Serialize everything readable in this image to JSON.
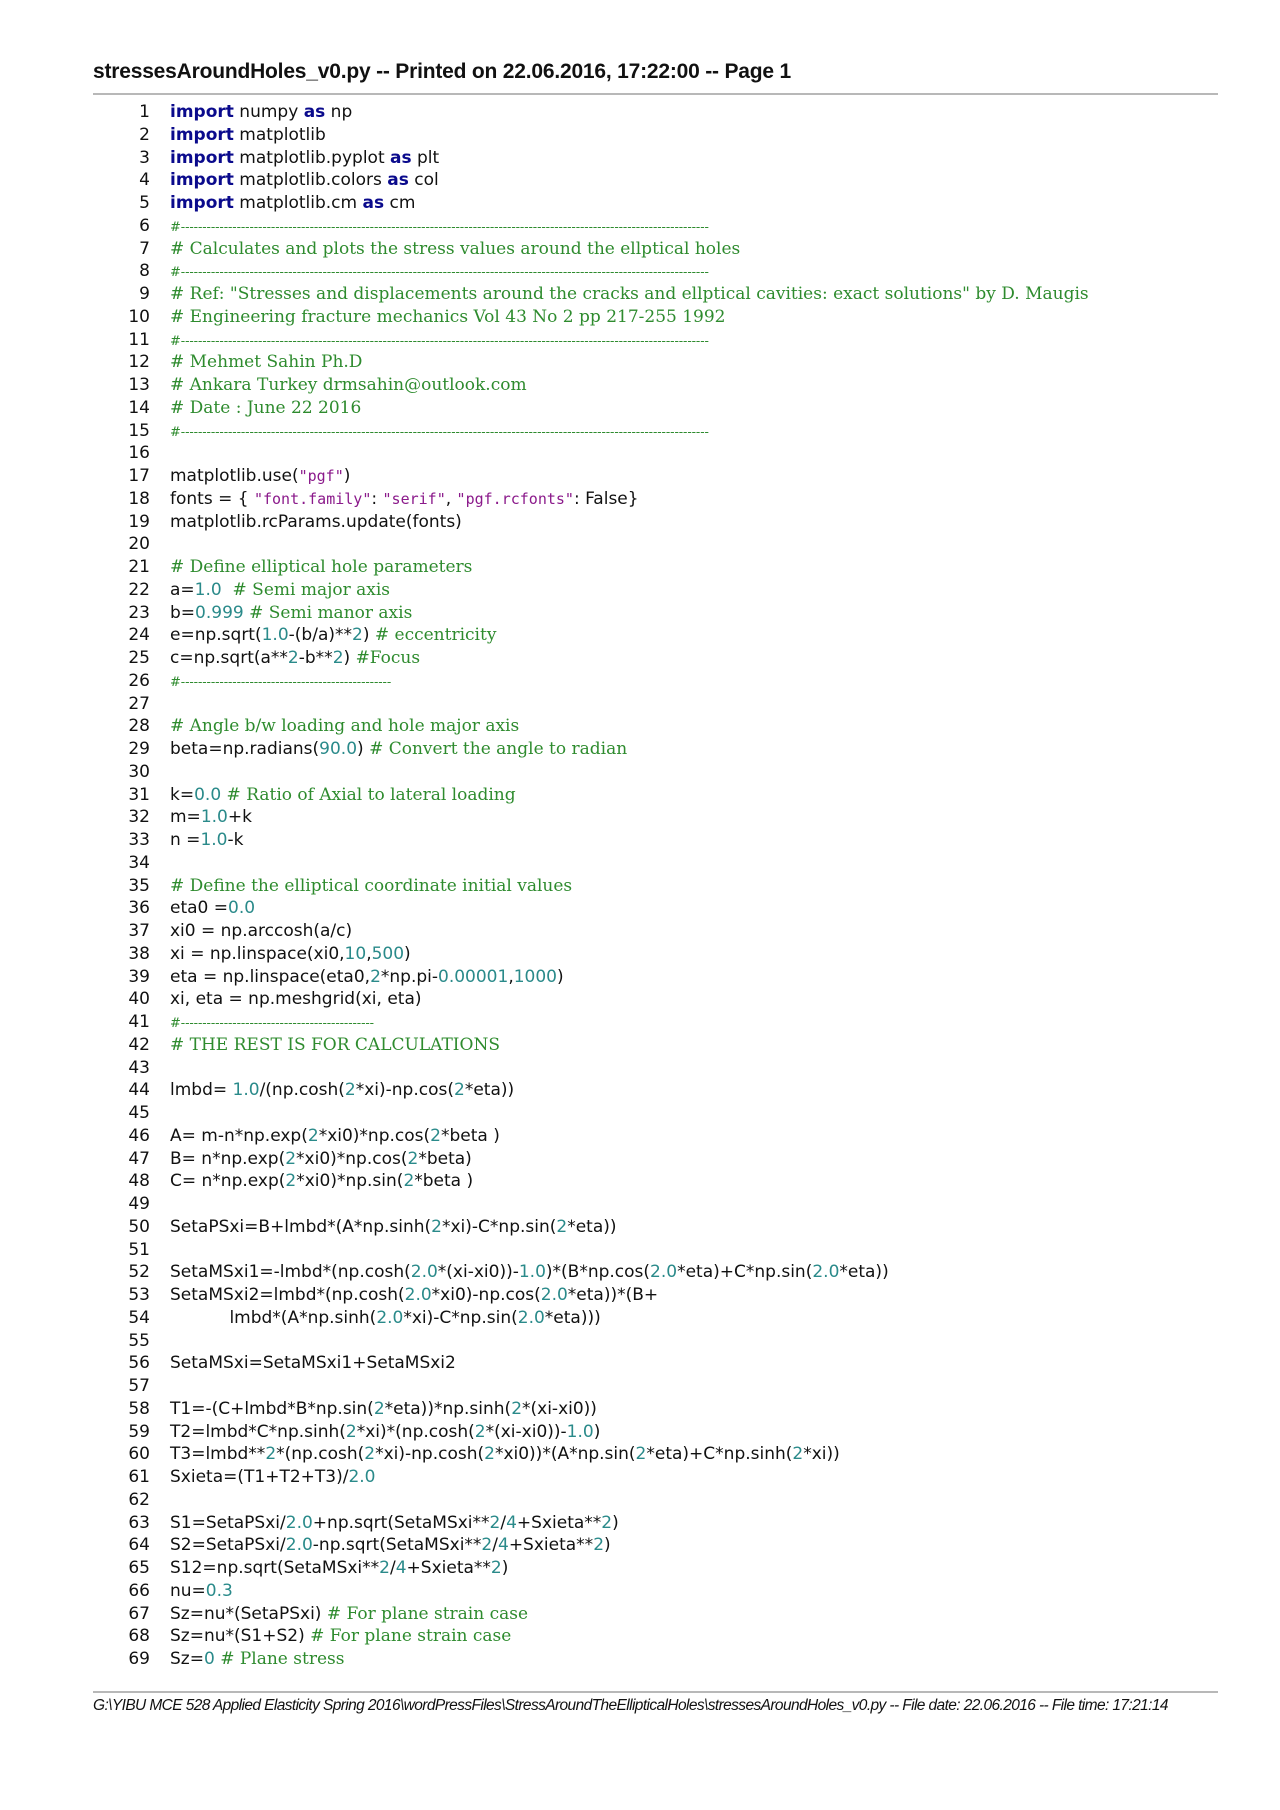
{
  "header": {
    "title": "stressesAroundHoles_v0.py -- Printed on 22.06.2016, 17:22:00 -- Page 1"
  },
  "footer": {
    "path": "G:\\YIBU MCE 528 Applied Elasticity Spring 2016\\wordPressFiles\\StressAroundTheEllipticalHoles\\stressesAroundHoles_v0.py -- File date: 22.06.2016 -- File time: 17:21:14"
  },
  "colors": {
    "keyword": "#0a0a8c",
    "number": "#2a8a8a",
    "string": "#8b1a8b",
    "comment": "#2e8b2e",
    "text": "#111111",
    "rule": "#b8b8b8"
  },
  "code": {
    "lines": [
      {
        "n": "1",
        "tokens": [
          [
            "kw",
            "import"
          ],
          [
            "t",
            " numpy "
          ],
          [
            "kw",
            "as"
          ],
          [
            "t",
            " np"
          ]
        ]
      },
      {
        "n": "2",
        "tokens": [
          [
            "kw",
            "import"
          ],
          [
            "t",
            " matplotlib"
          ]
        ]
      },
      {
        "n": "3",
        "tokens": [
          [
            "kw",
            "import"
          ],
          [
            "t",
            " matplotlib.pyplot "
          ],
          [
            "kw",
            "as"
          ],
          [
            "t",
            " plt"
          ]
        ]
      },
      {
        "n": "4",
        "tokens": [
          [
            "kw",
            "import"
          ],
          [
            "t",
            " matplotlib.colors "
          ],
          [
            "kw",
            "as"
          ],
          [
            "t",
            " col"
          ]
        ]
      },
      {
        "n": "5",
        "tokens": [
          [
            "kw",
            "import"
          ],
          [
            "t",
            " matplotlib.cm "
          ],
          [
            "kw",
            "as"
          ],
          [
            "t",
            " cm"
          ]
        ]
      },
      {
        "n": "6",
        "tokens": [
          [
            "dash",
            "#---------------------------------------------------------------------------------------------------------------------------"
          ]
        ]
      },
      {
        "n": "7",
        "tokens": [
          [
            "cm",
            "# Calculates and plots the stress values around the ellptical holes"
          ]
        ]
      },
      {
        "n": "8",
        "tokens": [
          [
            "dash",
            "#---------------------------------------------------------------------------------------------------------------------------"
          ]
        ]
      },
      {
        "n": "9",
        "tokens": [
          [
            "cm",
            "# Ref: \"Stresses and displacements around the cracks and ellptical cavities: exact solutions\" by D. Maugis"
          ]
        ]
      },
      {
        "n": "10",
        "tokens": [
          [
            "cm",
            "# Engineering fracture mechanics Vol 43 No 2 pp 217-255 1992"
          ]
        ]
      },
      {
        "n": "11",
        "tokens": [
          [
            "dash",
            "#---------------------------------------------------------------------------------------------------------------------------"
          ]
        ]
      },
      {
        "n": "12",
        "tokens": [
          [
            "cm",
            "# Mehmet Sahin Ph.D"
          ]
        ]
      },
      {
        "n": "13",
        "tokens": [
          [
            "cm",
            "# Ankara Turkey drmsahin@outlook.com"
          ]
        ]
      },
      {
        "n": "14",
        "tokens": [
          [
            "cm",
            "# Date : June 22 2016"
          ]
        ]
      },
      {
        "n": "15",
        "tokens": [
          [
            "dash",
            "#---------------------------------------------------------------------------------------------------------------------------"
          ]
        ]
      },
      {
        "n": "16",
        "tokens": []
      },
      {
        "n": "17",
        "tokens": [
          [
            "t",
            "matplotlib.use("
          ],
          [
            "str",
            "\"pgf\""
          ],
          [
            "t",
            ")"
          ]
        ]
      },
      {
        "n": "18",
        "tokens": [
          [
            "t",
            "fonts = { "
          ],
          [
            "str",
            "\"font.family\""
          ],
          [
            "t",
            ": "
          ],
          [
            "str",
            "\"serif\""
          ],
          [
            "t",
            ", "
          ],
          [
            "str",
            "\"pgf.rcfonts\""
          ],
          [
            "t",
            ": False}"
          ]
        ]
      },
      {
        "n": "19",
        "tokens": [
          [
            "t",
            "matplotlib.rcParams.update(fonts)"
          ]
        ]
      },
      {
        "n": "20",
        "tokens": []
      },
      {
        "n": "21",
        "tokens": [
          [
            "cm",
            "# Define elliptical hole parameters"
          ]
        ]
      },
      {
        "n": "22",
        "tokens": [
          [
            "t",
            "a="
          ],
          [
            "num",
            "1.0"
          ],
          [
            "t",
            "  "
          ],
          [
            "cm",
            "# Semi major axis"
          ]
        ]
      },
      {
        "n": "23",
        "tokens": [
          [
            "t",
            "b="
          ],
          [
            "num",
            "0.999"
          ],
          [
            "t",
            " "
          ],
          [
            "cm",
            "# Semi manor axis"
          ]
        ]
      },
      {
        "n": "24",
        "tokens": [
          [
            "t",
            "e=np.sqrt("
          ],
          [
            "num",
            "1.0"
          ],
          [
            "t",
            "-(b/a)**"
          ],
          [
            "num",
            "2"
          ],
          [
            "t",
            ") "
          ],
          [
            "cm",
            "# eccentricity"
          ]
        ]
      },
      {
        "n": "25",
        "tokens": [
          [
            "t",
            "c=np.sqrt(a**"
          ],
          [
            "num",
            "2"
          ],
          [
            "t",
            "-b**"
          ],
          [
            "num",
            "2"
          ],
          [
            "t",
            ") "
          ],
          [
            "cm",
            "#Focus"
          ]
        ]
      },
      {
        "n": "26",
        "tokens": [
          [
            "dash",
            "#-------------------------------------------------"
          ]
        ]
      },
      {
        "n": "27",
        "tokens": []
      },
      {
        "n": "28",
        "tokens": [
          [
            "cm",
            "# Angle b/w loading and hole major axis"
          ]
        ]
      },
      {
        "n": "29",
        "tokens": [
          [
            "t",
            "beta=np.radians("
          ],
          [
            "num",
            "90.0"
          ],
          [
            "t",
            ") "
          ],
          [
            "cm",
            "# Convert the angle to radian"
          ]
        ]
      },
      {
        "n": "30",
        "tokens": []
      },
      {
        "n": "31",
        "tokens": [
          [
            "t",
            "k="
          ],
          [
            "num",
            "0.0"
          ],
          [
            "t",
            " "
          ],
          [
            "cm",
            "# Ratio of Axial to lateral loading"
          ]
        ]
      },
      {
        "n": "32",
        "tokens": [
          [
            "t",
            "m="
          ],
          [
            "num",
            "1.0"
          ],
          [
            "t",
            "+k"
          ]
        ]
      },
      {
        "n": "33",
        "tokens": [
          [
            "t",
            "n ="
          ],
          [
            "num",
            "1.0"
          ],
          [
            "t",
            "-k"
          ]
        ]
      },
      {
        "n": "34",
        "tokens": []
      },
      {
        "n": "35",
        "tokens": [
          [
            "cm",
            "# Define the elliptical coordinate initial values"
          ]
        ]
      },
      {
        "n": "36",
        "tokens": [
          [
            "t",
            "eta0 ="
          ],
          [
            "num",
            "0.0"
          ]
        ]
      },
      {
        "n": "37",
        "tokens": [
          [
            "t",
            "xi0 = np.arccosh(a/c)"
          ]
        ]
      },
      {
        "n": "38",
        "tokens": [
          [
            "t",
            "xi = np.linspace(xi0,"
          ],
          [
            "num",
            "10"
          ],
          [
            "t",
            ","
          ],
          [
            "num",
            "500"
          ],
          [
            "t",
            ")"
          ]
        ]
      },
      {
        "n": "39",
        "tokens": [
          [
            "t",
            "eta = np.linspace(eta0,"
          ],
          [
            "num",
            "2"
          ],
          [
            "t",
            "*np.pi-"
          ],
          [
            "num",
            "0.00001"
          ],
          [
            "t",
            ","
          ],
          [
            "num",
            "1000"
          ],
          [
            "t",
            ")"
          ]
        ]
      },
      {
        "n": "40",
        "tokens": [
          [
            "t",
            "xi, eta = np.meshgrid(xi, eta)"
          ]
        ]
      },
      {
        "n": "41",
        "tokens": [
          [
            "dash",
            "#---------------------------------------------"
          ]
        ]
      },
      {
        "n": "42",
        "tokens": [
          [
            "cm",
            "# THE REST IS FOR CALCULATIONS"
          ]
        ]
      },
      {
        "n": "43",
        "tokens": []
      },
      {
        "n": "44",
        "tokens": [
          [
            "t",
            "lmbd= "
          ],
          [
            "num",
            "1.0"
          ],
          [
            "t",
            "/(np.cosh("
          ],
          [
            "num",
            "2"
          ],
          [
            "t",
            "*xi)-np.cos("
          ],
          [
            "num",
            "2"
          ],
          [
            "t",
            "*eta))"
          ]
        ]
      },
      {
        "n": "45",
        "tokens": []
      },
      {
        "n": "46",
        "tokens": [
          [
            "t",
            "A= m-n*np.exp("
          ],
          [
            "num",
            "2"
          ],
          [
            "t",
            "*xi0)*np.cos("
          ],
          [
            "num",
            "2"
          ],
          [
            "t",
            "*beta )"
          ]
        ]
      },
      {
        "n": "47",
        "tokens": [
          [
            "t",
            "B= n*np.exp("
          ],
          [
            "num",
            "2"
          ],
          [
            "t",
            "*xi0)*np.cos("
          ],
          [
            "num",
            "2"
          ],
          [
            "t",
            "*beta)"
          ]
        ]
      },
      {
        "n": "48",
        "tokens": [
          [
            "t",
            "C= n*np.exp("
          ],
          [
            "num",
            "2"
          ],
          [
            "t",
            "*xi0)*np.sin("
          ],
          [
            "num",
            "2"
          ],
          [
            "t",
            "*beta )"
          ]
        ]
      },
      {
        "n": "49",
        "tokens": []
      },
      {
        "n": "50",
        "tokens": [
          [
            "t",
            "SetaPSxi=B+lmbd*(A*np.sinh("
          ],
          [
            "num",
            "2"
          ],
          [
            "t",
            "*xi)-C*np.sin("
          ],
          [
            "num",
            "2"
          ],
          [
            "t",
            "*eta))"
          ]
        ]
      },
      {
        "n": "51",
        "tokens": []
      },
      {
        "n": "52",
        "tokens": [
          [
            "t",
            "SetaMSxi1=-lmbd*(np.cosh("
          ],
          [
            "num",
            "2.0"
          ],
          [
            "t",
            "*(xi-xi0))-"
          ],
          [
            "num",
            "1.0"
          ],
          [
            "t",
            ")*(B*np.cos("
          ],
          [
            "num",
            "2.0"
          ],
          [
            "t",
            "*eta)+C*np.sin("
          ],
          [
            "num",
            "2.0"
          ],
          [
            "t",
            "*eta))"
          ]
        ]
      },
      {
        "n": "53",
        "tokens": [
          [
            "t",
            "SetaMSxi2=lmbd*(np.cosh("
          ],
          [
            "num",
            "2.0"
          ],
          [
            "t",
            "*xi0)-np.cos("
          ],
          [
            "num",
            "2.0"
          ],
          [
            "t",
            "*eta))*(B+"
          ]
        ]
      },
      {
        "n": "54",
        "tokens": [
          [
            "t",
            "           lmbd*(A*np.sinh("
          ],
          [
            "num",
            "2.0"
          ],
          [
            "t",
            "*xi)-C*np.sin("
          ],
          [
            "num",
            "2.0"
          ],
          [
            "t",
            "*eta)))"
          ]
        ]
      },
      {
        "n": "55",
        "tokens": []
      },
      {
        "n": "56",
        "tokens": [
          [
            "t",
            "SetaMSxi=SetaMSxi1+SetaMSxi2"
          ]
        ]
      },
      {
        "n": "57",
        "tokens": []
      },
      {
        "n": "58",
        "tokens": [
          [
            "t",
            "T1=-(C+lmbd*B*np.sin("
          ],
          [
            "num",
            "2"
          ],
          [
            "t",
            "*eta))*np.sinh("
          ],
          [
            "num",
            "2"
          ],
          [
            "t",
            "*(xi-xi0))"
          ]
        ]
      },
      {
        "n": "59",
        "tokens": [
          [
            "t",
            "T2=lmbd*C*np.sinh("
          ],
          [
            "num",
            "2"
          ],
          [
            "t",
            "*xi)*(np.cosh("
          ],
          [
            "num",
            "2"
          ],
          [
            "t",
            "*(xi-xi0))-"
          ],
          [
            "num",
            "1.0"
          ],
          [
            "t",
            ")"
          ]
        ]
      },
      {
        "n": "60",
        "tokens": [
          [
            "t",
            "T3=lmbd**"
          ],
          [
            "num",
            "2"
          ],
          [
            "t",
            "*(np.cosh("
          ],
          [
            "num",
            "2"
          ],
          [
            "t",
            "*xi)-np.cosh("
          ],
          [
            "num",
            "2"
          ],
          [
            "t",
            "*xi0))*(A*np.sin("
          ],
          [
            "num",
            "2"
          ],
          [
            "t",
            "*eta)+C*np.sinh("
          ],
          [
            "num",
            "2"
          ],
          [
            "t",
            "*xi))"
          ]
        ]
      },
      {
        "n": "61",
        "tokens": [
          [
            "t",
            "Sxieta=(T1+T2+T3)/"
          ],
          [
            "num",
            "2.0"
          ]
        ]
      },
      {
        "n": "62",
        "tokens": []
      },
      {
        "n": "63",
        "tokens": [
          [
            "t",
            "S1=SetaPSxi/"
          ],
          [
            "num",
            "2.0"
          ],
          [
            "t",
            "+np.sqrt(SetaMSxi**"
          ],
          [
            "num",
            "2"
          ],
          [
            "t",
            "/"
          ],
          [
            "num",
            "4"
          ],
          [
            "t",
            "+Sxieta**"
          ],
          [
            "num",
            "2"
          ],
          [
            "t",
            ")"
          ]
        ]
      },
      {
        "n": "64",
        "tokens": [
          [
            "t",
            "S2=SetaPSxi/"
          ],
          [
            "num",
            "2.0"
          ],
          [
            "t",
            "-np.sqrt(SetaMSxi**"
          ],
          [
            "num",
            "2"
          ],
          [
            "t",
            "/"
          ],
          [
            "num",
            "4"
          ],
          [
            "t",
            "+Sxieta**"
          ],
          [
            "num",
            "2"
          ],
          [
            "t",
            ")"
          ]
        ]
      },
      {
        "n": "65",
        "tokens": [
          [
            "t",
            "S12=np.sqrt(SetaMSxi**"
          ],
          [
            "num",
            "2"
          ],
          [
            "t",
            "/"
          ],
          [
            "num",
            "4"
          ],
          [
            "t",
            "+Sxieta**"
          ],
          [
            "num",
            "2"
          ],
          [
            "t",
            ")"
          ]
        ]
      },
      {
        "n": "66",
        "tokens": [
          [
            "t",
            "nu="
          ],
          [
            "num",
            "0.3"
          ]
        ]
      },
      {
        "n": "67",
        "tokens": [
          [
            "t",
            "Sz=nu*(SetaPSxi) "
          ],
          [
            "cm",
            "# For plane strain case"
          ]
        ]
      },
      {
        "n": "68",
        "tokens": [
          [
            "t",
            "Sz=nu*(S1+S2) "
          ],
          [
            "cm",
            "# For plane strain case"
          ]
        ]
      },
      {
        "n": "69",
        "tokens": [
          [
            "t",
            "Sz="
          ],
          [
            "num",
            "0"
          ],
          [
            "t",
            " "
          ],
          [
            "cm",
            "# Plane stress"
          ]
        ]
      }
    ]
  }
}
